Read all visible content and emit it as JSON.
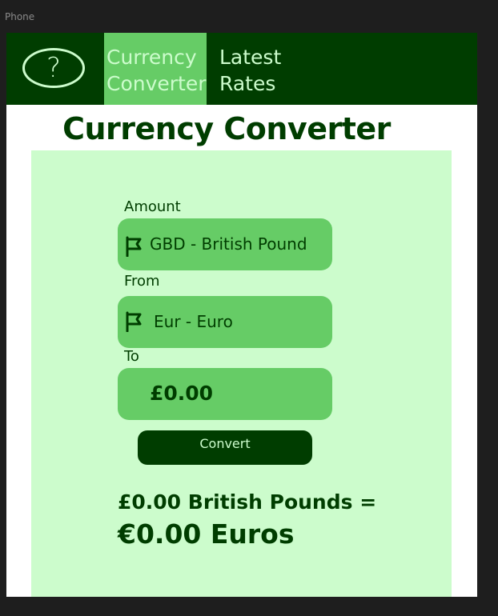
{
  "frame": {
    "label": "Phone"
  },
  "navbar": {
    "help_icon": "question-mark-icon",
    "help_glyph": "?",
    "tabs": [
      {
        "label": "Currency\nConverter",
        "active": true
      },
      {
        "label": "Latest\nRates",
        "active": false
      }
    ]
  },
  "page": {
    "title": "Currency Converter"
  },
  "form": {
    "amount_label": "Amount",
    "amount_value": "GBD - British Pound",
    "from_label": "From",
    "from_value": "Eur - Euro",
    "to_label": "To",
    "to_value": "£0.00",
    "convert_label": "Convert"
  },
  "result": {
    "line1": "£0.00 British Pounds =",
    "line2": "€0.00 Euros"
  },
  "colors": {
    "dark_green": "#003d00",
    "mid_green": "#66cc66",
    "light_green": "#ccfccc"
  }
}
